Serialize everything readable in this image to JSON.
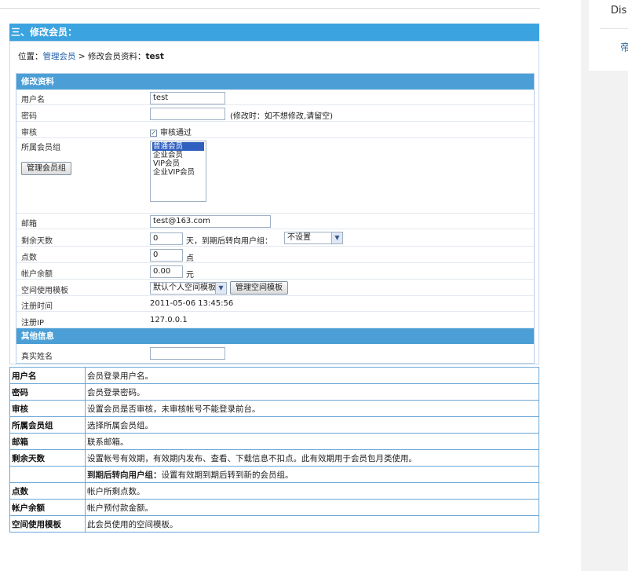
{
  "section_title": "三、修改会员：",
  "breadcrumb": {
    "prefix": "位置：",
    "link": "管理会员",
    "sep": " > ",
    "current_label": "修改会员资料：",
    "current_user": "test"
  },
  "form": {
    "header": "修改资料",
    "username_label": "用户名",
    "username_value": "test",
    "password_label": "密码",
    "password_hint": "(修改时：如不想修改,请留空)",
    "audit_label": "审核",
    "audit_check_label": "审核通过",
    "audit_checked": true,
    "group_label": "所属会员组",
    "group_button": "管理会员组",
    "group_options": [
      "普通会员",
      "企业会员",
      "VIP会员",
      "企业VIP会员"
    ],
    "group_selected": "普通会员",
    "email_label": "邮箱",
    "email_value": "test@163.com",
    "days_label": "剩余天数",
    "days_value": "0",
    "days_suffix": "天，到期后转向用户组：",
    "days_group_select": "不设置",
    "points_label": "点数",
    "points_value": "0",
    "points_unit": "点",
    "balance_label": "帐户余额",
    "balance_value": "0.00",
    "balance_unit": "元",
    "space_label": "空间使用模板",
    "space_select": "默认个人空间模板",
    "space_button": "管理空间模板",
    "regtime_label": "注册时间",
    "regtime_value": "2011-05-06 13:45:56",
    "regip_label": "注册IP",
    "regip_value": "127.0.0.1",
    "other_header": "其他信息",
    "realname_label": "真实姓名"
  },
  "desc_rows": [
    {
      "k": "用户名",
      "v": "会员登录用户名。"
    },
    {
      "k": "密码",
      "v": "会员登录密码。"
    },
    {
      "k": "审核",
      "v": "设置会员是否审核，未审核帐号不能登录前台。"
    },
    {
      "k": "所属会员组",
      "v": "选择所属会员组。"
    },
    {
      "k": "邮箱",
      "v": "联系邮箱。"
    },
    {
      "k": "剩余天数",
      "v": "设置帐号有效期，有效期内发布、查看、下载信息不扣点。此有效期用于会员包月类使用。"
    },
    {
      "k": "",
      "vb": "到期后转向用户组：",
      "v": "设置有效期到期后转到新的会员组。"
    },
    {
      "k": "点数",
      "v": "帐户所剩点数。"
    },
    {
      "k": "帐户余额",
      "v": "帐户预付款金额。"
    },
    {
      "k": "空间使用模板",
      "v": "此会员使用的空间模板。"
    }
  ],
  "sidebar": {
    "text1": "Dis",
    "text2": "帝"
  }
}
